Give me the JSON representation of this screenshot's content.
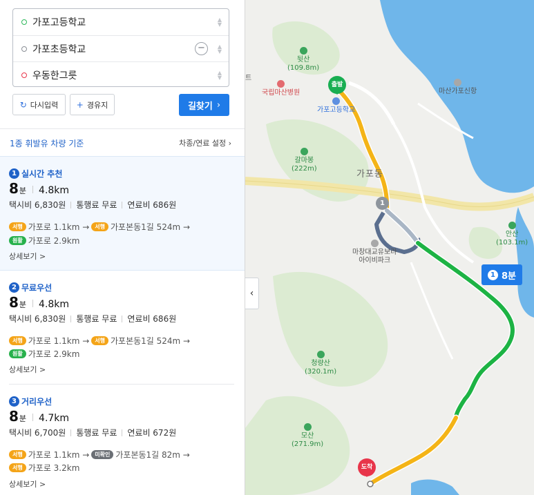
{
  "waypoints": [
    {
      "label": "가포고등학교",
      "type": "start"
    },
    {
      "label": "가포초등학교",
      "type": "via"
    },
    {
      "label": "우동한그릇",
      "type": "end"
    }
  ],
  "buttons": {
    "reset_label": "다시입력",
    "via_label": "경유지",
    "find_label": "길찾기"
  },
  "vehicle": {
    "label": "1종 휘발유 차량 기준",
    "setting_label": "차종/연료 설정"
  },
  "routes": [
    {
      "num": "1",
      "title": "실시간 추천",
      "time": "8",
      "unit": "분",
      "distance": "4.8km",
      "taxi": "택시비 6,830원",
      "toll": "통행료 무료",
      "fuel": "연료비 686원",
      "steps1": [
        {
          "tag": "서행",
          "tag_type": "slow",
          "text": "가포로 1.1km →"
        },
        {
          "tag": "서행",
          "tag_type": "slow",
          "text": "가포본동1길 524m →"
        }
      ],
      "steps2": [
        {
          "tag": "원활",
          "tag_type": "smooth",
          "text": "가포로 2.9km"
        }
      ],
      "detail": "상세보기 >"
    },
    {
      "num": "2",
      "title": "무료우선",
      "time": "8",
      "unit": "분",
      "distance": "4.8km",
      "taxi": "택시비 6,830원",
      "toll": "통행료 무료",
      "fuel": "연료비 686원",
      "steps1": [
        {
          "tag": "서행",
          "tag_type": "slow",
          "text": "가포로 1.1km →"
        },
        {
          "tag": "서행",
          "tag_type": "slow",
          "text": "가포본동1길 524m →"
        }
      ],
      "steps2": [
        {
          "tag": "원활",
          "tag_type": "smooth",
          "text": "가포로 2.9km"
        }
      ],
      "detail": "상세보기 >"
    },
    {
      "num": "3",
      "title": "거리우선",
      "time": "8",
      "unit": "분",
      "distance": "4.7km",
      "taxi": "택시비 6,700원",
      "toll": "통행료 무료",
      "fuel": "연료비 672원",
      "steps1": [
        {
          "tag": "서행",
          "tag_type": "slow",
          "text": "가포로 1.1km →"
        },
        {
          "tag": "미확인",
          "tag_type": "unk",
          "text": "가포본동1길 82m →"
        }
      ],
      "steps2": [
        {
          "tag": "서행",
          "tag_type": "slow",
          "text": "가포로 3.2km"
        }
      ],
      "detail": "상세보기 >"
    }
  ],
  "map": {
    "labels": {
      "duitsan": "뒷산",
      "duitsan_h": "(109.8m)",
      "hospital": "국립마산병원",
      "port": "마산가포신항",
      "school": "가포고등학교",
      "galmabong": "갈마봉",
      "galmabong_h": "(222m)",
      "town": "가포동",
      "ansan": "안산",
      "ansan_h": "(103.1m)",
      "park1": "마창대교유보라",
      "park2": "아이비파크",
      "cheongryang": "청량산",
      "cheongryang_h": "(320.1m)",
      "mosan": "모산",
      "mosan_h": "(271.9m)",
      "edge_char": "트"
    },
    "start_pin": "출발",
    "end_pin": "도착",
    "waypoint_num": "1",
    "route_badge_num": "1",
    "route_badge_time": "8분",
    "colors": {
      "sea": "#6fb6ea",
      "land": "#f0f0ed",
      "green_area": "#dcebd2",
      "slow": "#f4b417",
      "smooth": "#1db344",
      "alt_route": "#5b6f8f"
    }
  }
}
